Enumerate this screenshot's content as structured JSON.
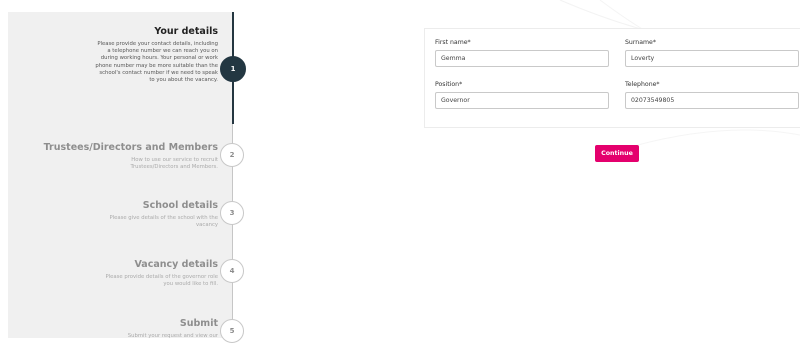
{
  "steps": [
    {
      "number": "1",
      "title": "Your details",
      "description": "Please provide your contact details, including a telephone number we can reach you on during working hours. Your personal or work phone number may be more suitable than the school's contact number if we need to speak to you about the vacancy.",
      "active": true
    },
    {
      "number": "2",
      "title": "Trustees/Directors and Members",
      "description": "How to use our service to recruit Trustees/Directors and Members.",
      "active": false
    },
    {
      "number": "3",
      "title": "School details",
      "description": "Please give details of the school with the vacancy",
      "active": false
    },
    {
      "number": "4",
      "title": "Vacancy details",
      "description": "Please provide details of the governor role you would like to fill.",
      "active": false
    },
    {
      "number": "5",
      "title": "Submit",
      "description": "Submit your request and view our",
      "active": false
    }
  ],
  "form": {
    "first_name": {
      "label": "First name*",
      "value": "Gemma"
    },
    "surname": {
      "label": "Surname*",
      "value": "Loverty"
    },
    "position": {
      "label": "Position*",
      "value": "Governor"
    },
    "telephone": {
      "label": "Telephone*",
      "value": "02073549805"
    }
  },
  "continue_label": "Continue",
  "colors": {
    "active_step": "#233742",
    "accent": "#e4006d",
    "sidebar_bg": "#f0f0f0"
  }
}
